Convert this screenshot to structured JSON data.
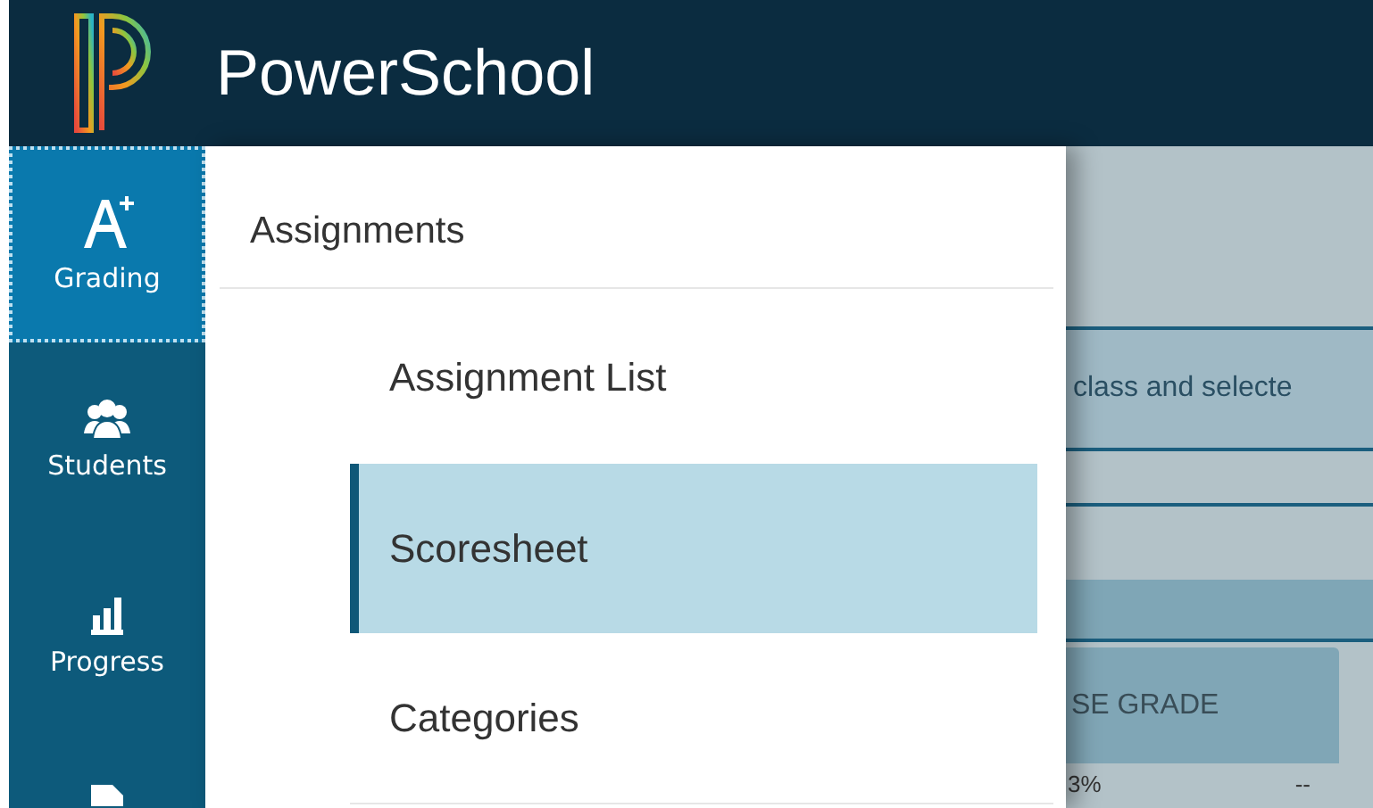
{
  "header": {
    "brand": "PowerSchool"
  },
  "nav": [
    {
      "label": "Grading",
      "selected": true
    },
    {
      "label": "Students",
      "selected": false
    },
    {
      "label": "Progress",
      "selected": false
    },
    {
      "selected": false
    }
  ],
  "menu": {
    "title": "Assignments",
    "items": [
      {
        "label": "Assignment List",
        "selected": false
      },
      {
        "label": "Scoresheet",
        "selected": true
      },
      {
        "label": "Categories",
        "selected": false
      }
    ]
  },
  "background": {
    "notice": "class and selecte",
    "column_header": "SE GRADE",
    "cells": [
      "3%",
      "--"
    ]
  }
}
